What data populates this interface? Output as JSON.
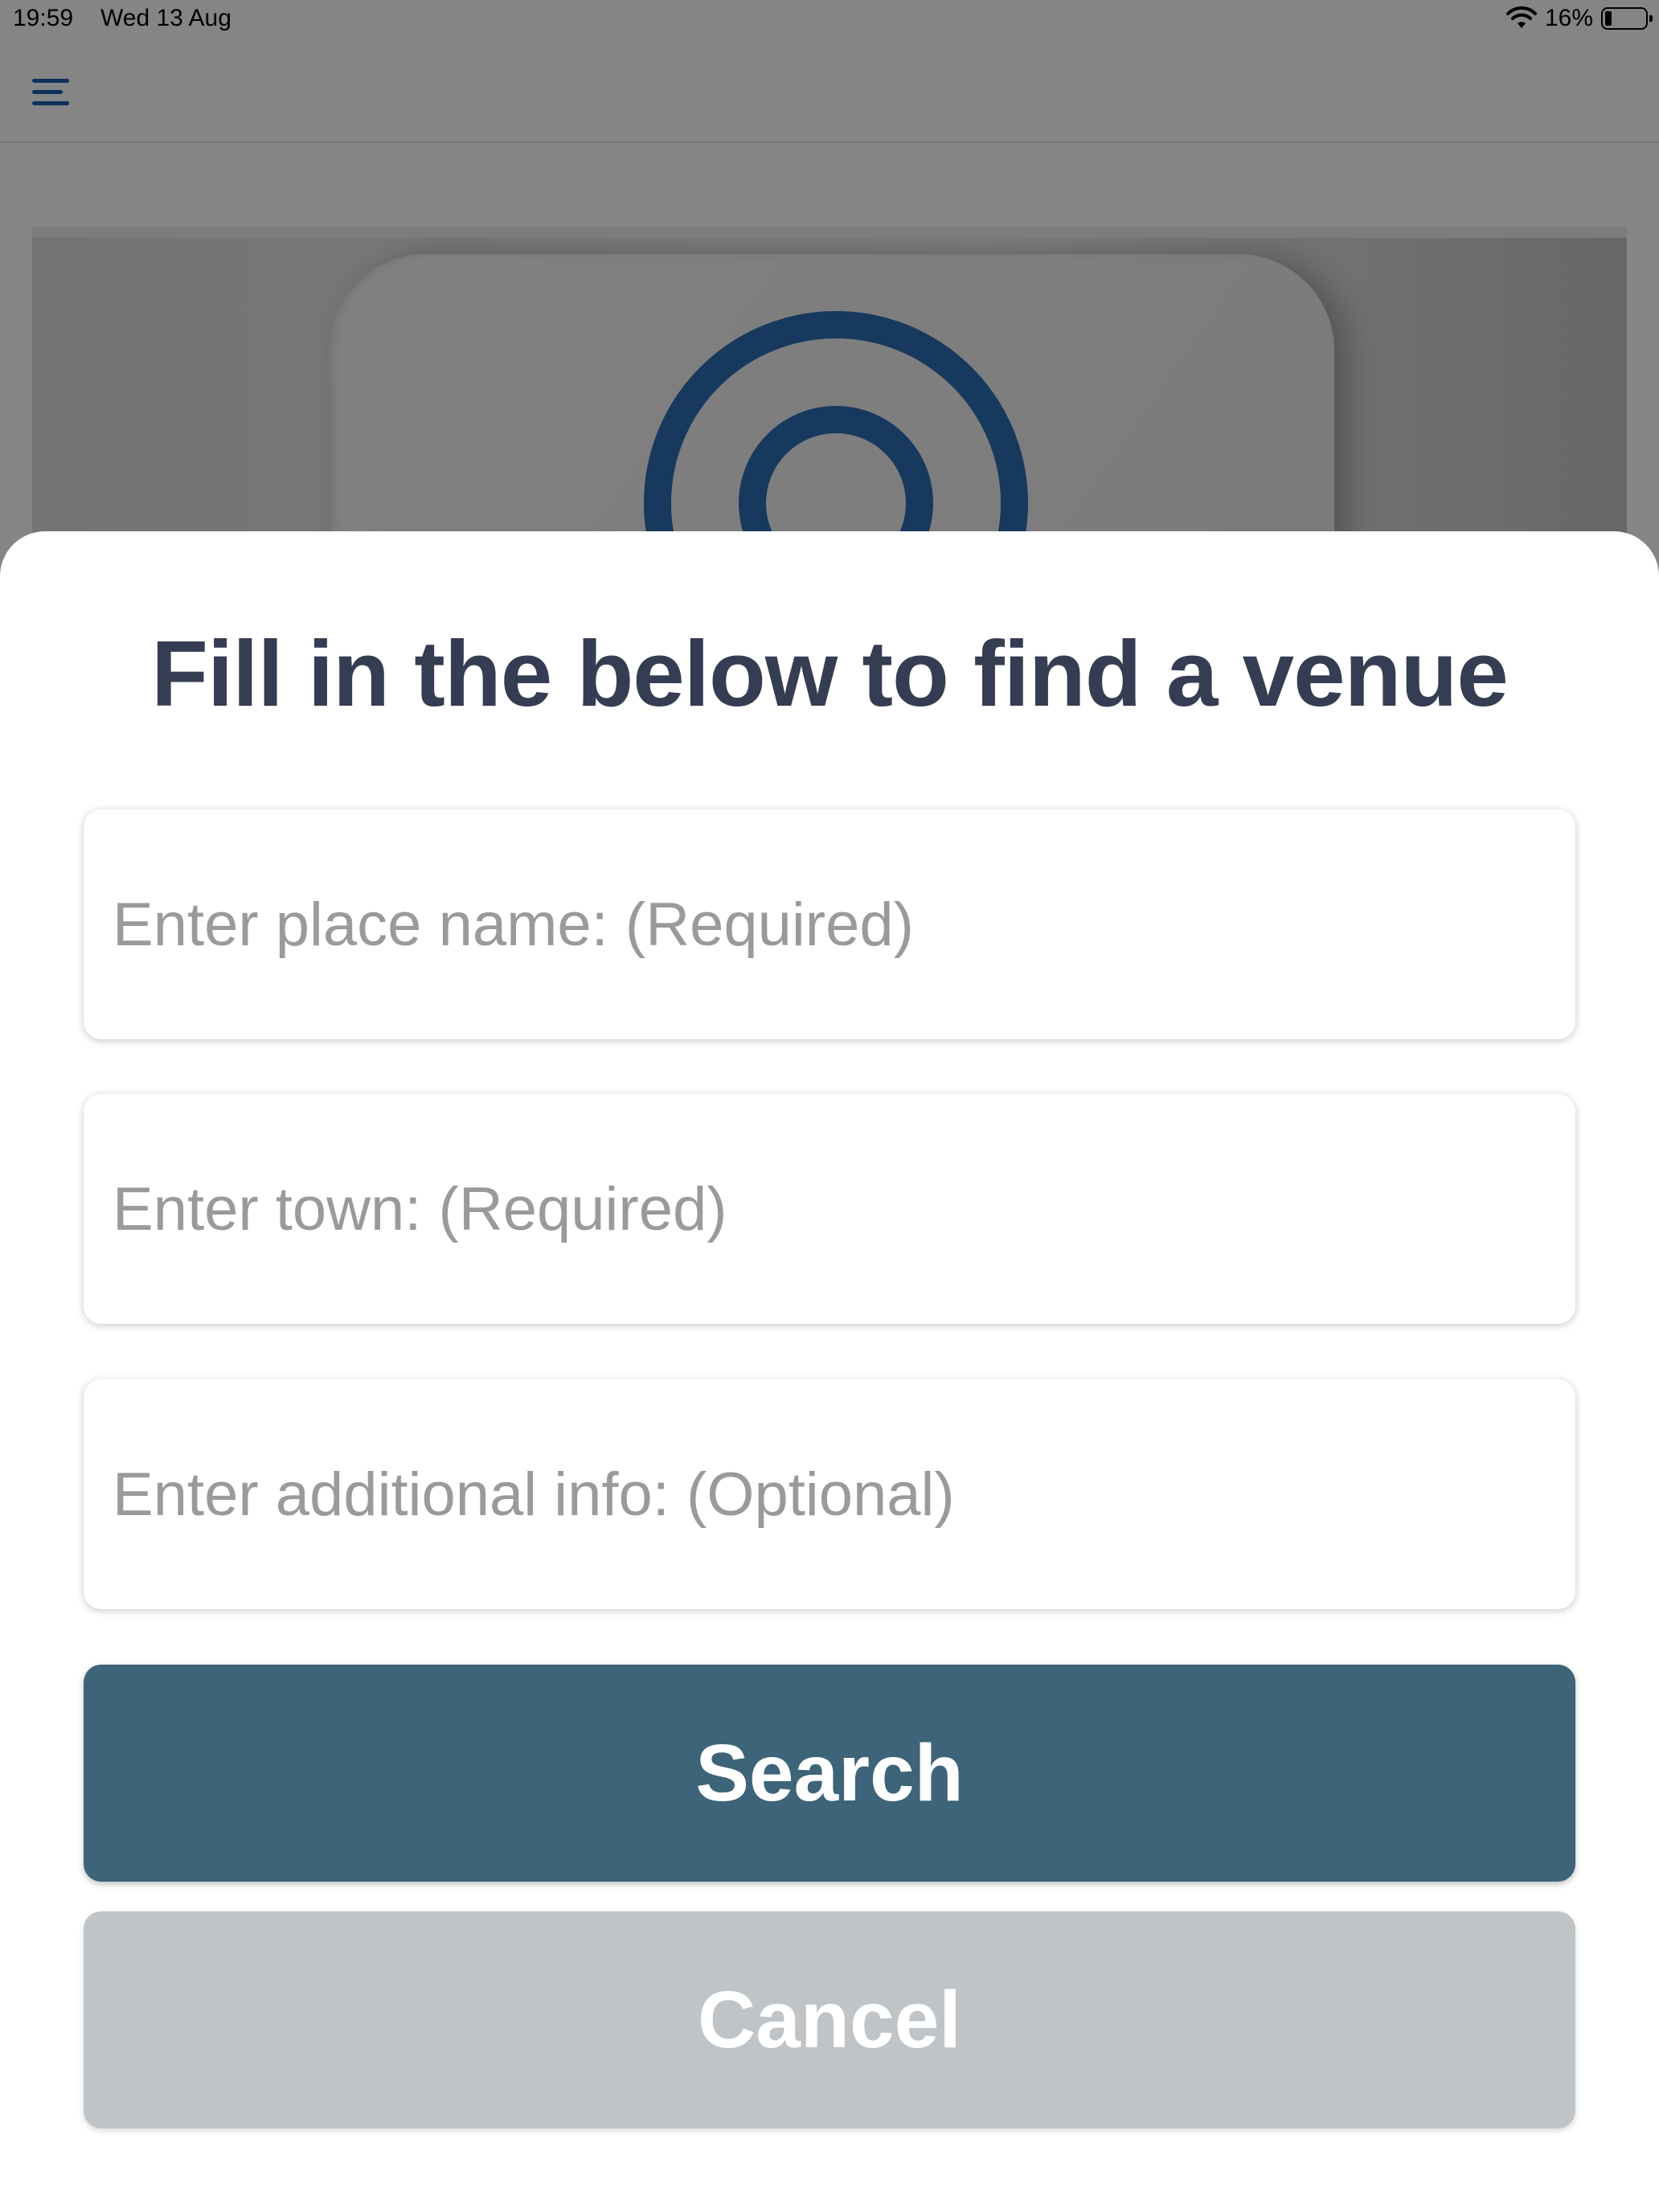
{
  "status_bar": {
    "time": "19:59",
    "date": "Wed 13 Aug",
    "battery": "16%",
    "battery_level": 0.16
  },
  "nav": {
    "menu_icon": "hamburger-menu-icon"
  },
  "colors": {
    "accent": "#1c5dae",
    "title": "#353d52",
    "search_button": "#3d6478",
    "cancel_button": "#bfc4c8",
    "placeholder": "#9a9a9a"
  },
  "form": {
    "title": "Fill in the below to find a venue",
    "place_placeholder": "Enter place name: (Required)",
    "town_placeholder": "Enter town: (Required)",
    "info_placeholder": "Enter additional info: (Optional)",
    "search_label": "Search",
    "cancel_label": "Cancel"
  }
}
